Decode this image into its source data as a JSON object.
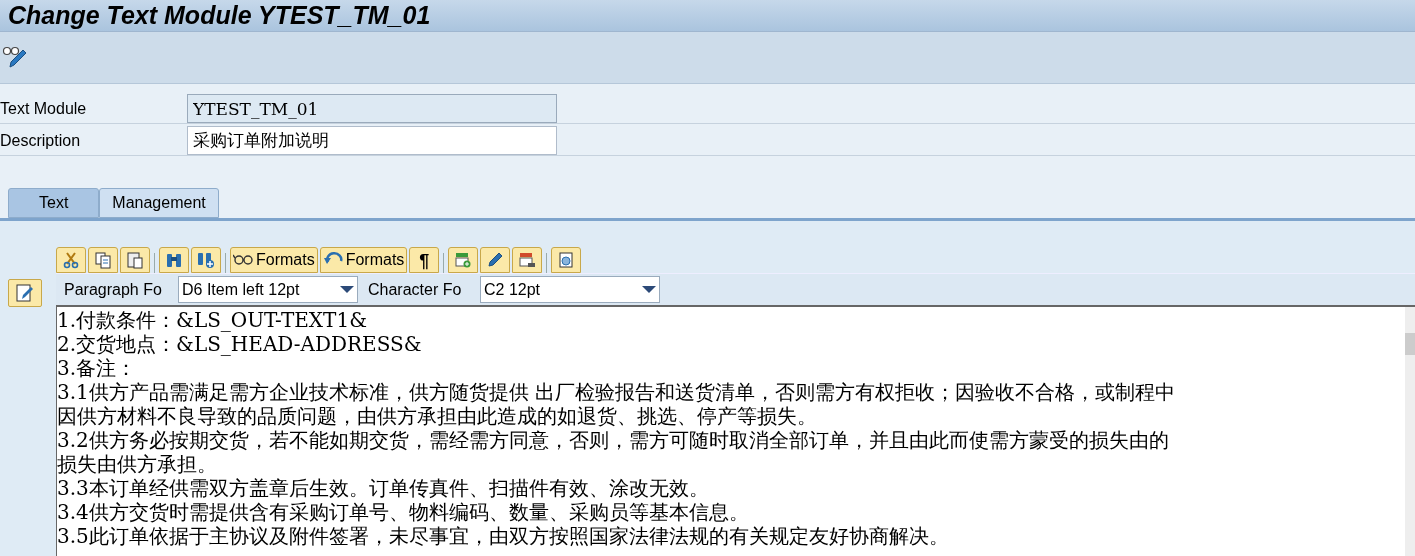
{
  "window": {
    "title": "Change Text Module YTEST_TM_01"
  },
  "fields": [
    {
      "label": "Text Module",
      "value": "YTEST_TM_01",
      "disabled": true
    },
    {
      "label": "Description",
      "value": "采购订单附加说明",
      "disabled": false
    }
  ],
  "tabs": [
    {
      "label": "Text",
      "selected": true
    },
    {
      "label": "Management",
      "selected": false
    }
  ],
  "editor_toolbar": [
    {
      "kind": "icon"
    },
    {
      "kind": "icon"
    },
    {
      "kind": "icon"
    },
    {
      "kind": "sep"
    },
    {
      "kind": "icon"
    },
    {
      "kind": "icon"
    },
    {
      "kind": "sep"
    },
    {
      "kind": "text",
      "label": "Formats"
    },
    {
      "kind": "text",
      "label": "Formats"
    },
    {
      "kind": "char",
      "label": "¶"
    },
    {
      "kind": "sep"
    },
    {
      "kind": "icon"
    },
    {
      "kind": "icon"
    },
    {
      "kind": "icon"
    },
    {
      "kind": "sep"
    },
    {
      "kind": "icon"
    }
  ],
  "format_bar": {
    "paragraph_label": "Paragraph Fo",
    "paragraph_value": "D6 Item left 12pt",
    "character_label": "Character Fo",
    "character_value": "C2 12pt"
  },
  "text_lines": [
    "1.付款条件：&LS_OUT-TEXT1&",
    "2.交货地点：&LS_HEAD-ADDRESS&",
    "3.备注：",
    "3.1供方产品需满足需方企业技术标准，供方随货提供 出厂检验报告和送货清单，否则需方有权拒收；因验收不合格，或制程中",
    "因供方材料不良导致的品质问题，由供方承担由此造成的如退货、挑选、停产等损失。",
    "3.2供方务必按期交货，若不能如期交货，需经需方同意，否则，需方可随时取消全部订单，并且由此而使需方蒙受的损失由的",
    "损失由供方承担。",
    "3.3本订单经供需双方盖章后生效。订单传真件、扫描件有效、涂改无效。",
    "3.4供方交货时需提供含有采购订单号、物料编码、数量、采购员等基本信息。",
    "3.5此订单依据于主协议及附件签署，未尽事宜，由双方按照国家法律法规的有关规定友好协商解决。"
  ]
}
